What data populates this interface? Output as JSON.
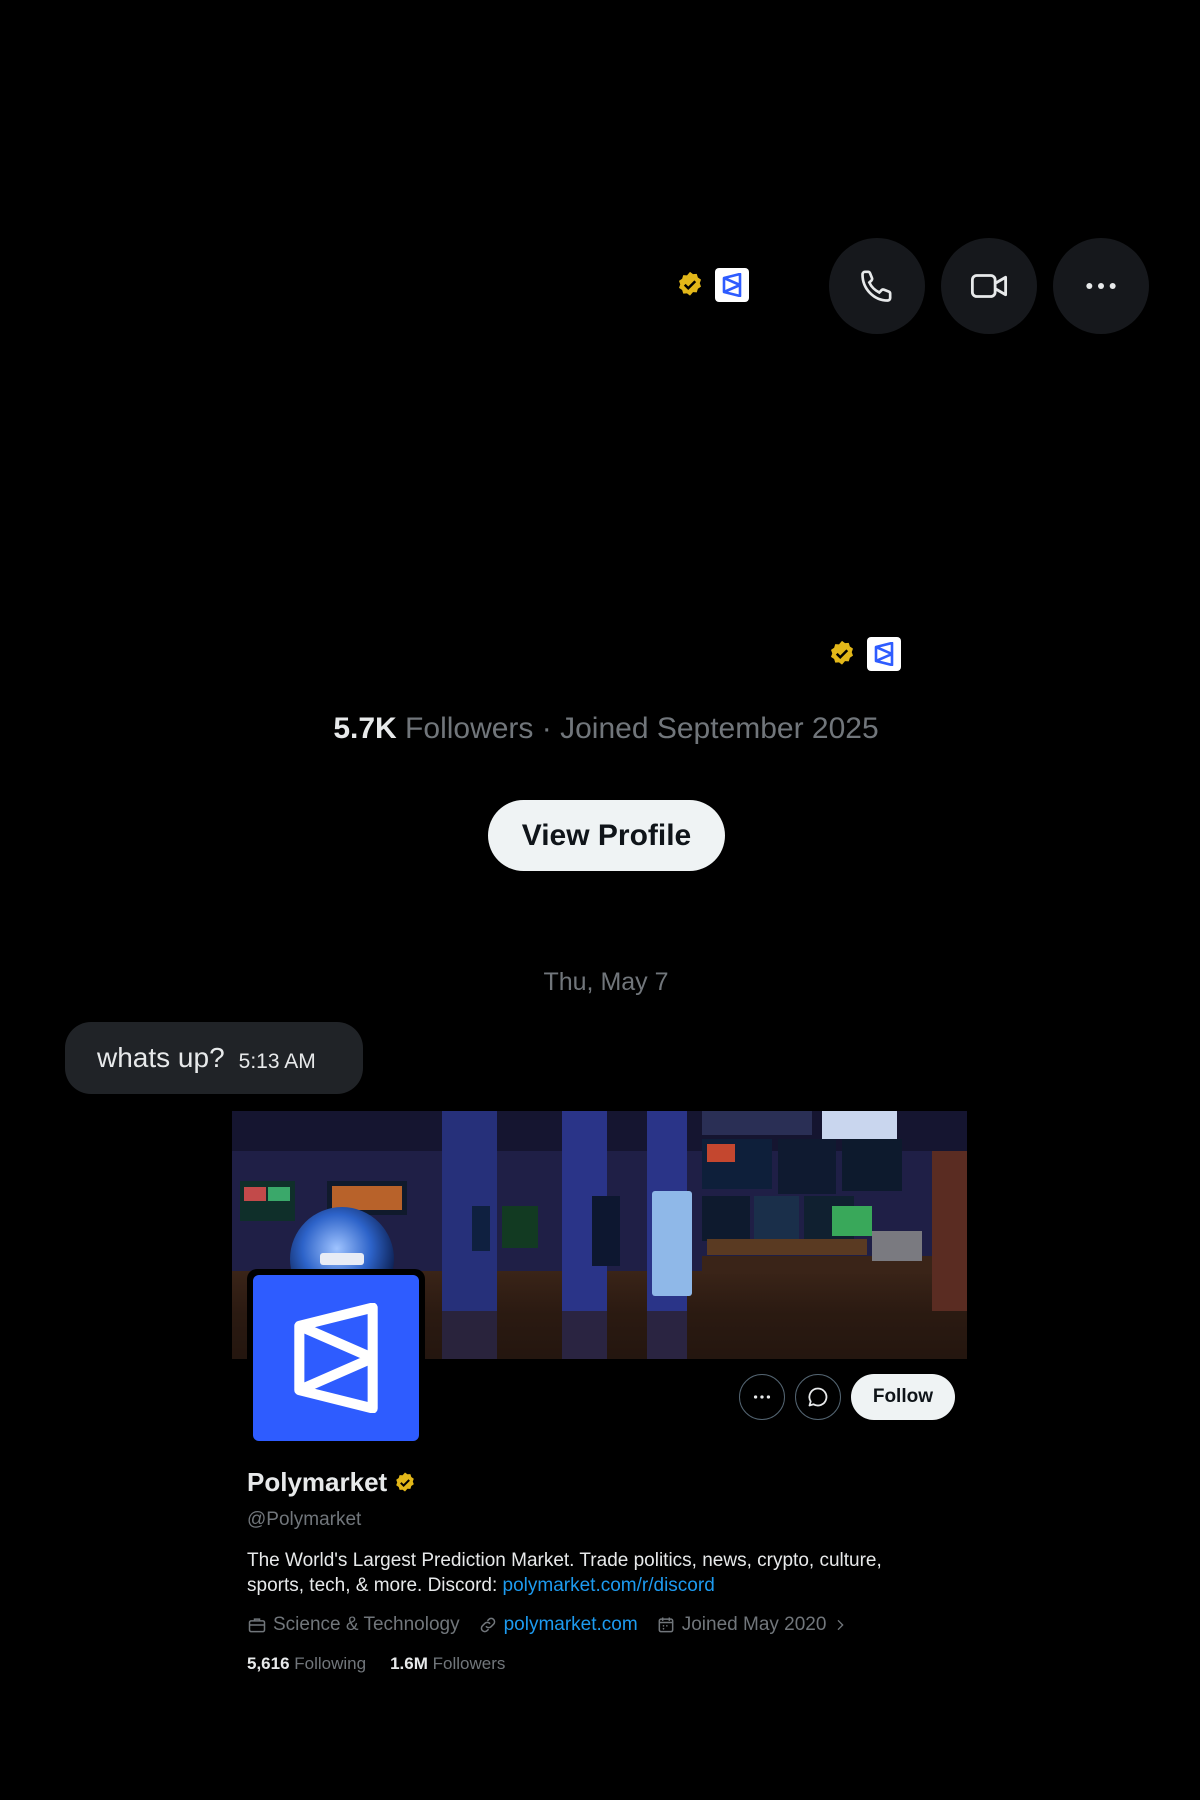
{
  "header": {
    "icons": [
      "verified-badge-icon",
      "polymarket-affiliate-icon"
    ],
    "actions": [
      "phone-icon",
      "video-icon",
      "more-icon"
    ]
  },
  "summary": {
    "followers_count": "5.7K",
    "followers_label": " Followers",
    "separator": " · ",
    "joined": "Joined September 2025",
    "view_profile_label": "View Profile"
  },
  "chat": {
    "date": "Thu, May 7",
    "messages": [
      {
        "text": "whats up?",
        "time": "5:13 AM"
      }
    ]
  },
  "profile_card": {
    "name": "Polymarket",
    "handle": "@Polymarket",
    "bio_text": "The World's Largest Prediction Market. Trade politics, news, crypto, culture, sports, tech, & more. Discord: ",
    "bio_link": "polymarket.com/r/discord",
    "category": "Science & Technology",
    "website": "polymarket.com",
    "joined": "Joined May 2020",
    "following_count": "5,616",
    "following_label": "Following",
    "followers_count": "1.6M",
    "followers_label": "Followers",
    "follow_label": "Follow"
  },
  "colors": {
    "background": "#000000",
    "accent_link": "#1d9bf0",
    "brand_blue": "#2e5cff",
    "verified_gold": "#e2b719",
    "muted_text": "#71767b"
  }
}
